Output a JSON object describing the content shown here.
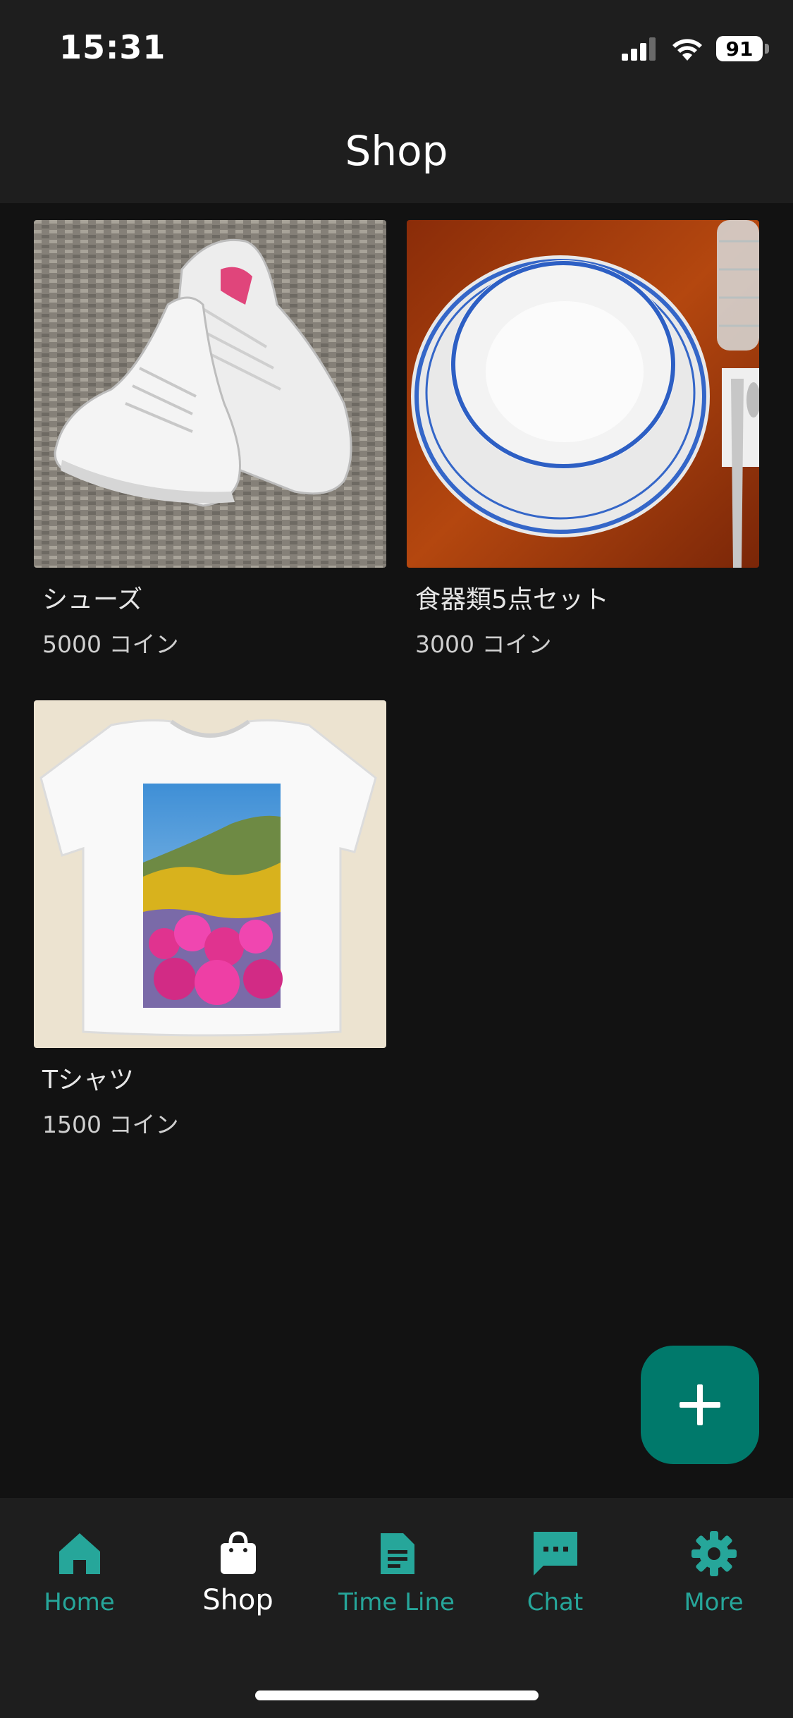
{
  "status_bar": {
    "time": "15:31",
    "battery_level": "91",
    "icons": [
      "cellular-signal-icon",
      "wifi-icon",
      "battery-icon"
    ]
  },
  "app_bar": {
    "title": "Shop"
  },
  "products": [
    {
      "name": "シューズ",
      "price": "5000 コイン",
      "image": "white-sneakers-photo"
    },
    {
      "name": "食器類5点セット",
      "price": "3000 コイン",
      "image": "blue-rimmed-plates-photo"
    },
    {
      "name": "Tシャツ",
      "price": "1500 コイン",
      "image": "printed-tshirt-photo"
    }
  ],
  "fab": {
    "icon": "plus-icon"
  },
  "bottom_nav": {
    "items": [
      {
        "label": "Home",
        "icon": "home-icon",
        "active": false
      },
      {
        "label": "Shop",
        "icon": "shopping-bag-icon",
        "active": true
      },
      {
        "label": "Time Line",
        "icon": "document-icon",
        "active": false
      },
      {
        "label": "Chat",
        "icon": "chat-bubble-icon",
        "active": false
      },
      {
        "label": "More",
        "icon": "gear-icon",
        "active": false
      }
    ]
  },
  "colors": {
    "background": "#121212",
    "bar_background": "#1e1e1e",
    "accent_teal": "#26a69a",
    "fab": "#00796b"
  }
}
